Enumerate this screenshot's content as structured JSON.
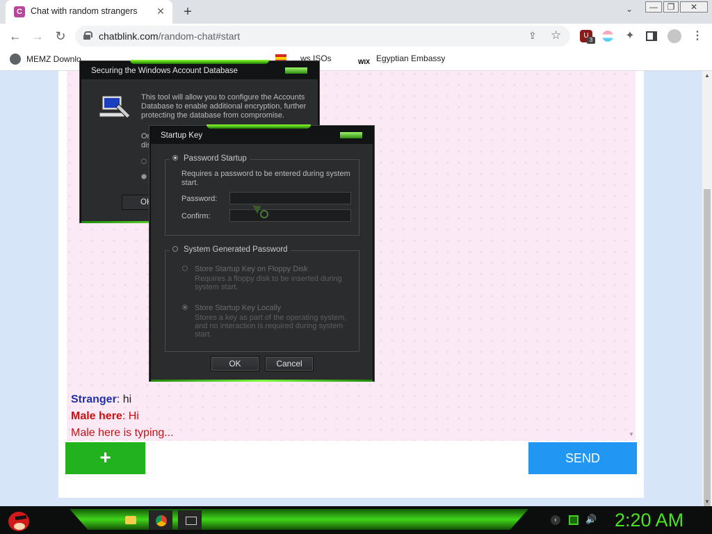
{
  "browser": {
    "tab": {
      "title": "Chat with random strangers",
      "favicon_letter": "C",
      "close_glyph": "✕"
    },
    "new_tab_glyph": "+",
    "window_controls": {
      "minimize": "—",
      "maximize": "❐",
      "close": "✕",
      "tab_search": "⌄"
    },
    "nav": {
      "back": "←",
      "forward": "→",
      "reload": "↻"
    },
    "omnibox": {
      "domain": "chatblink.com",
      "path": "/random-chat#start",
      "share_glyph": "⇪",
      "star_glyph": "☆"
    },
    "extensions": {
      "shield_badge": "3",
      "puzzle_glyph": "✦",
      "menu_glyph": "⋮",
      "shield_glyph": "U"
    },
    "bookmarks": [
      {
        "label": "MEMZ Downlo…"
      },
      {
        "label": "…ws ISOs"
      },
      {
        "icon_text": "WIX",
        "label": "Egyptian Embassy"
      }
    ]
  },
  "chat": {
    "messages": [
      {
        "sender": "Stranger",
        "text": ": hi"
      },
      {
        "sender": "Male here",
        "text": ": Hi"
      }
    ],
    "typing_text": "Male here is typing...",
    "add_label": "+",
    "send_label": "SEND",
    "input_value": ""
  },
  "dialogs": {
    "security": {
      "title": "Securing the Windows Account Database",
      "intro": "This tool will allow you to configure the Accounts Database to enable additional encryption, further protecting the database from compromise.",
      "fragment": "On\ndis",
      "ok_fragment": "OK"
    },
    "startup_key": {
      "title": "Startup Key",
      "password_startup": {
        "label": "Password Startup",
        "description": "Requires a password to be entered during system start.",
        "password_label": "Password:",
        "confirm_label": "Confirm:"
      },
      "system_generated": {
        "label": "System Generated Password",
        "floppy": {
          "label": "Store Startup Key on Floppy Disk",
          "description": "Requires a floppy disk to be inserted during system start."
        },
        "local": {
          "label": "Store Startup Key Locally",
          "description": "Stores a key as part of the operating system, and no interaction is required during system start."
        }
      },
      "ok_label": "OK",
      "cancel_label": "Cancel"
    }
  },
  "taskbar": {
    "clock": "2:20 AM",
    "tray_chevron": "‹",
    "volume_glyph": "🔊"
  },
  "colors": {
    "add_button": "#22b21e",
    "send_button": "#2196f3",
    "stranger_name": "#1e2fa8",
    "male_name": "#cc1010",
    "clock": "#48e321"
  }
}
